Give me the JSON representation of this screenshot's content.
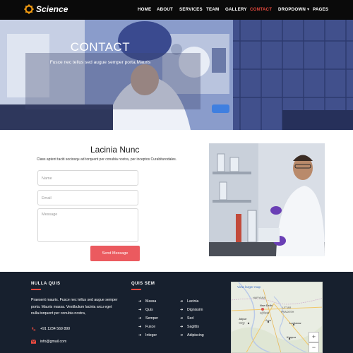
{
  "nav": {
    "brand": "Science",
    "items": [
      "HOME",
      "ABOUT",
      "SERVICES",
      "TEAM",
      "GALLERY",
      "CONTACT",
      "DROPDOWN ▾",
      "PAGES"
    ],
    "active": "CONTACT",
    "accent": "#e94a3f"
  },
  "hero": {
    "title": "CONTACT",
    "subtitle": "Fusce nec tellus sed augue semper porta.Mauris"
  },
  "contact": {
    "title": "Lacinia Nunc",
    "description": "Class aptent taciti sociosqu ad torquent per conubia nostra, per inceptos Curabiturodales.",
    "name_placeholder": "Name",
    "email_placeholder": "Email",
    "message_placeholder": "Message",
    "send_label": "Send Message",
    "button_color": "#eb5a5f"
  },
  "footer": {
    "col1_title": "NULLA QUIS",
    "col1_text": "Praesent mauris. Fusce nec tellus sed augue semper porta. Mauris massa. Vestibulum lacinia arcu eget nulla.torquent per conubia nostra,",
    "phone": "+91 1234 569 890",
    "email": "info@gmail.com",
    "col2_title": "QUIS SEM",
    "links_left": [
      "Massa",
      "Quis",
      "Semper",
      "Fusce",
      "Integer"
    ],
    "links_right": [
      "Lacinia",
      "Dignissim",
      "Sed",
      "Sagittis",
      "Adipiscing"
    ],
    "map": {
      "link": "View larger map",
      "labels": [
        "HARYANA",
        "New Delhi",
        "नई दिल्ली",
        "UTTAR",
        "PRADESH",
        "Jaipur",
        "जयपुर",
        "Agra",
        "Lucknow",
        "Kanpur"
      ],
      "zoom_in": "+",
      "zoom_out": "−"
    },
    "background": "#17202e"
  }
}
